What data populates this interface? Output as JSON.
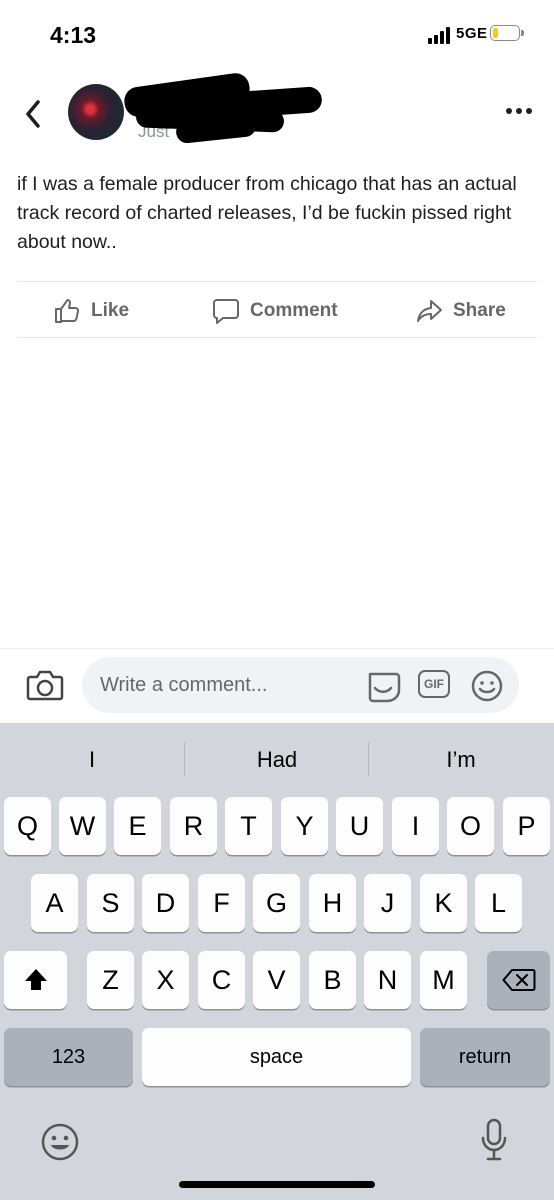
{
  "status_bar": {
    "time": "4:13",
    "network": "5GE",
    "signal_bars": 4,
    "battery_level": 0.2,
    "battery_color": "#f5d300"
  },
  "header": {
    "timestamp": "Just"
  },
  "post": {
    "text": "if I was a female producer from chicago that has an actual track record of charted releases, I’d be fuckin pissed right about now..",
    "actions": {
      "like": "Like",
      "comment": "Comment",
      "share": "Share"
    }
  },
  "comment_bar": {
    "placeholder": "Write a comment...",
    "gif_label": "GIF"
  },
  "keyboard": {
    "suggestions": [
      "I",
      "Had",
      "I’m"
    ],
    "row1": [
      "Q",
      "W",
      "E",
      "R",
      "T",
      "Y",
      "U",
      "I",
      "O",
      "P"
    ],
    "row2": [
      "A",
      "S",
      "D",
      "F",
      "G",
      "H",
      "J",
      "K",
      "L"
    ],
    "row3": [
      "Z",
      "X",
      "C",
      "V",
      "B",
      "N",
      "M"
    ],
    "numbers_label": "123",
    "space_label": "space",
    "return_label": "return"
  },
  "colors": {
    "action_gray": "#65676b",
    "keyboard_bg": "#d2d5db"
  }
}
